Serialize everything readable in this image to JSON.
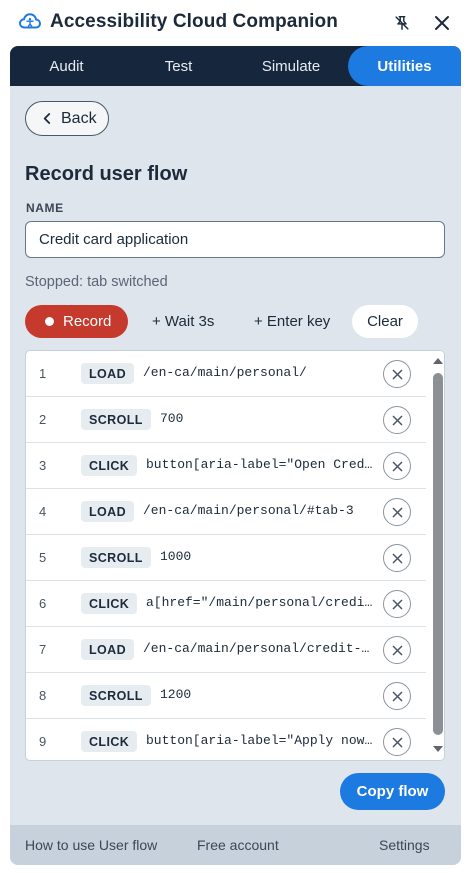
{
  "app": {
    "title": "Accessibility Cloud Companion",
    "logo_icon": "cloud-accessibility-icon",
    "accent_color": "#1d7ae0",
    "record_color": "#c53a2c"
  },
  "tabs": [
    {
      "label": "Audit",
      "active": false
    },
    {
      "label": "Test",
      "active": false
    },
    {
      "label": "Simulate",
      "active": false
    },
    {
      "label": "Utilities",
      "active": true
    }
  ],
  "back_label": "Back",
  "section_title": "Record user flow",
  "name_field": {
    "label": "NAME",
    "value": "Credit card application"
  },
  "status": "Stopped: tab switched",
  "actions": {
    "record": "Record",
    "wait": "+ Wait 3s",
    "enter": "+ Enter key",
    "clear": "Clear"
  },
  "steps": [
    {
      "num": "1",
      "action": "LOAD",
      "value": "/en-ca/main/personal/"
    },
    {
      "num": "2",
      "action": "SCROLL",
      "value": "700"
    },
    {
      "num": "3",
      "action": "CLICK",
      "value": "button[aria-label=\"Open Credit…"
    },
    {
      "num": "4",
      "action": "LOAD",
      "value": "/en-ca/main/personal/#tab-3"
    },
    {
      "num": "5",
      "action": "SCROLL",
      "value": "1000"
    },
    {
      "num": "6",
      "action": "CLICK",
      "value": "a[href=\"/main/personal/credit-…"
    },
    {
      "num": "7",
      "action": "LOAD",
      "value": "/en-ca/main/personal/credit-ca…"
    },
    {
      "num": "8",
      "action": "SCROLL",
      "value": "1200"
    },
    {
      "num": "9",
      "action": "CLICK",
      "value": "button[aria-label=\"Apply now f…"
    }
  ],
  "copy_label": "Copy flow",
  "footer": {
    "how_to": "How to use User flow",
    "free_account": "Free account",
    "settings": "Settings"
  }
}
